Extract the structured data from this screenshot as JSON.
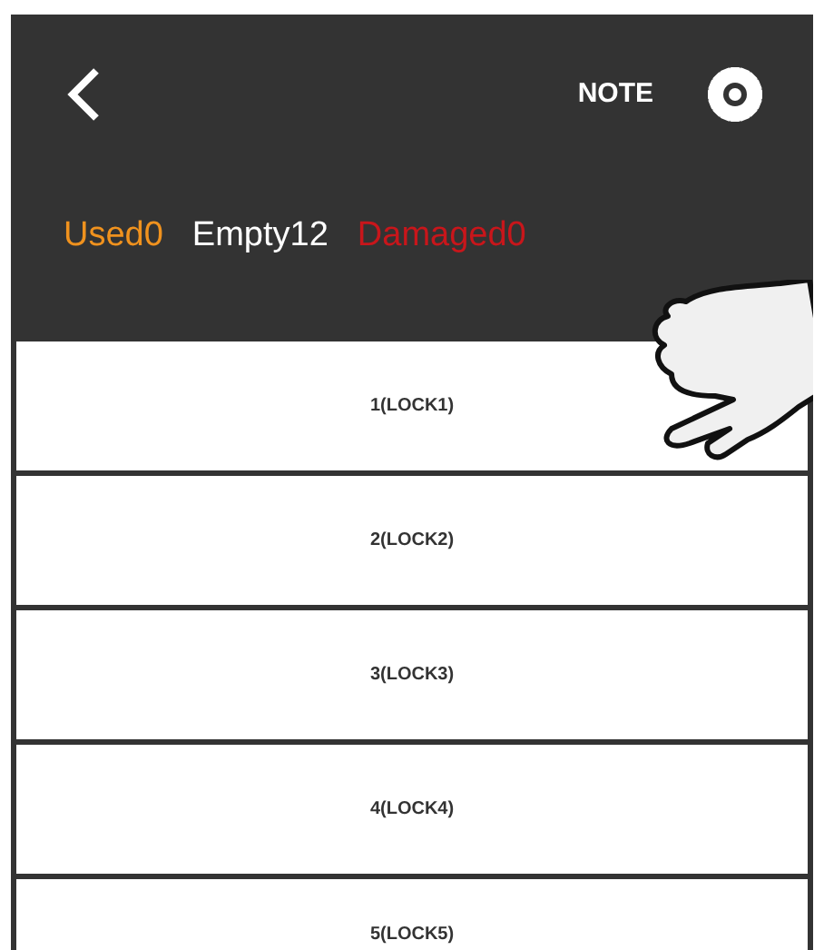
{
  "header": {
    "note": "NOTE"
  },
  "stats": [
    {
      "label": "Used0",
      "color": "#f0921e"
    },
    {
      "label": "Empty12",
      "color": "#ffffff"
    },
    {
      "label": "Damaged0",
      "color": "#c8161b"
    }
  ],
  "locks": [
    "1(LOCK1)",
    "2(LOCK2)",
    "3(LOCK3)",
    "4(LOCK4)",
    "5(LOCK5)"
  ]
}
